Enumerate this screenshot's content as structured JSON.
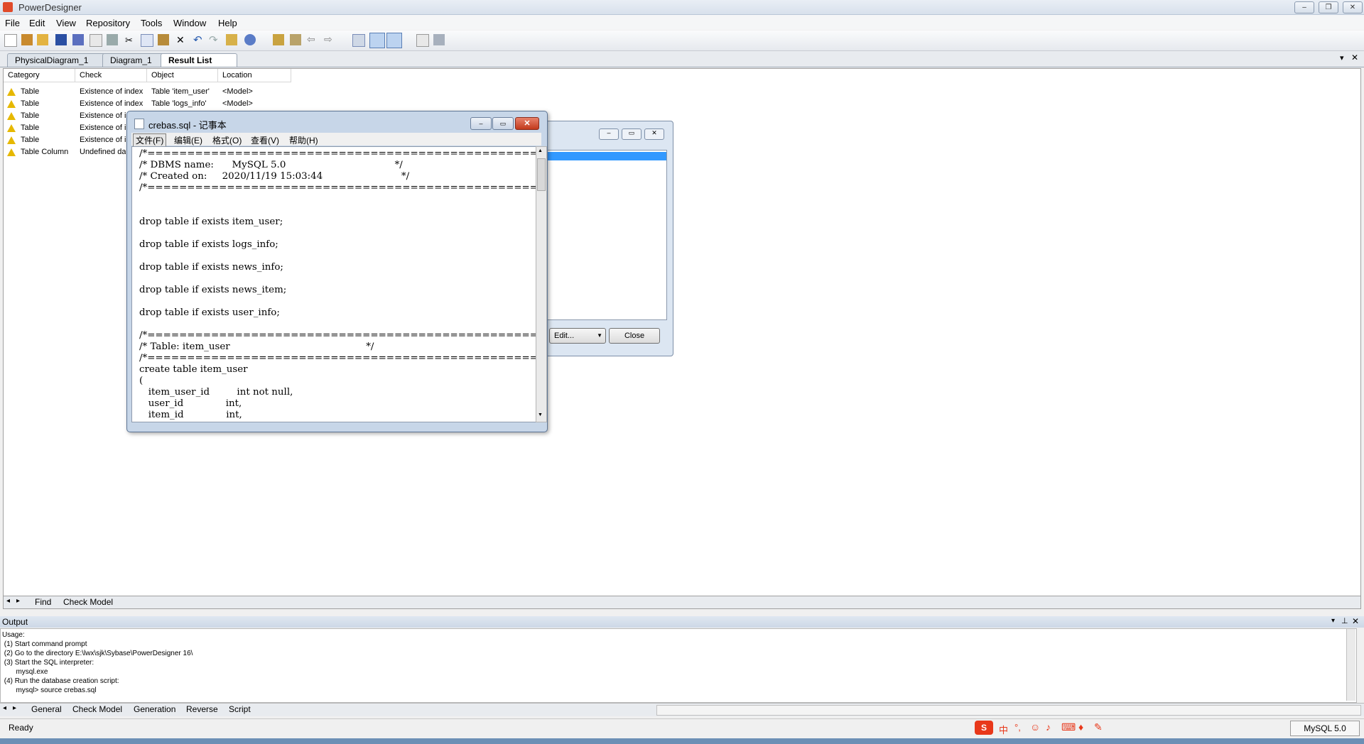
{
  "app": {
    "title": "PowerDesigner"
  },
  "menubar": {
    "items": [
      "File",
      "Edit",
      "View",
      "Repository",
      "Tools",
      "Window",
      "Help"
    ]
  },
  "tabs": [
    {
      "label": "PhysicalDiagram_1"
    },
    {
      "label": "Diagram_1"
    },
    {
      "label": "Result List"
    }
  ],
  "results": {
    "columns": [
      "Category",
      "Check",
      "Object",
      "Location"
    ],
    "rows": [
      {
        "category": "Table",
        "check": "Existence of index",
        "object": "Table 'item_user'",
        "location": "<Model>"
      },
      {
        "category": "Table",
        "check": "Existence of index",
        "object": "Table 'logs_info'",
        "location": "<Model>"
      },
      {
        "category": "Table",
        "check": "Existence of i",
        "object": "",
        "location": ""
      },
      {
        "category": "Table",
        "check": "Existence of i",
        "object": "",
        "location": ""
      },
      {
        "category": "Table",
        "check": "Existence of i",
        "object": "",
        "location": ""
      },
      {
        "category": "Table Column",
        "check": "Undefined dat",
        "object": "",
        "location": ""
      }
    ],
    "bottom_tabs": [
      "Find",
      "Check Model"
    ]
  },
  "dialog": {
    "edit_label": "Edit...",
    "close_label": "Close"
  },
  "notepad": {
    "title": "crebas.sql - 记事本",
    "menu": [
      "文件(F)",
      "编辑(E)",
      "格式(O)",
      "查看(V)",
      "帮助(H)"
    ],
    "content": "/*==============================================================*/\n/* DBMS name:      MySQL 5.0                                    */\n/* Created on:     2020/11/19 15:03:44                          */\n/*==============================================================*/\n\n\ndrop table if exists item_user;\n\ndrop table if exists logs_info;\n\ndrop table if exists news_info;\n\ndrop table if exists news_item;\n\ndrop table if exists user_info;\n\n/*==============================================================*/\n/* Table: item_user                                             */\n/*==============================================================*/\ncreate table item_user\n(\n   item_user_id         int not null,\n   user_id              int,\n   item_id              int,"
  },
  "output": {
    "title": "Output",
    "lines": [
      "Usage:",
      " (1) Start command prompt",
      " (2) Go to the directory E:\\lwx\\sjk\\Sybase\\PowerDesigner 16\\",
      " (3) Start the SQL interpreter:",
      "       mysql.exe",
      " (4) Run the database creation script:",
      "       mysql> source crebas.sql"
    ],
    "tabs": [
      "General",
      "Check Model",
      "Generation",
      "Reverse",
      "Script"
    ]
  },
  "status": {
    "text": "Ready",
    "dbms": "MySQL 5.0",
    "ime_label": "中"
  },
  "colors": {
    "warning": "#e6b800",
    "selection": "#3399ff",
    "ime": "#e8381a"
  }
}
